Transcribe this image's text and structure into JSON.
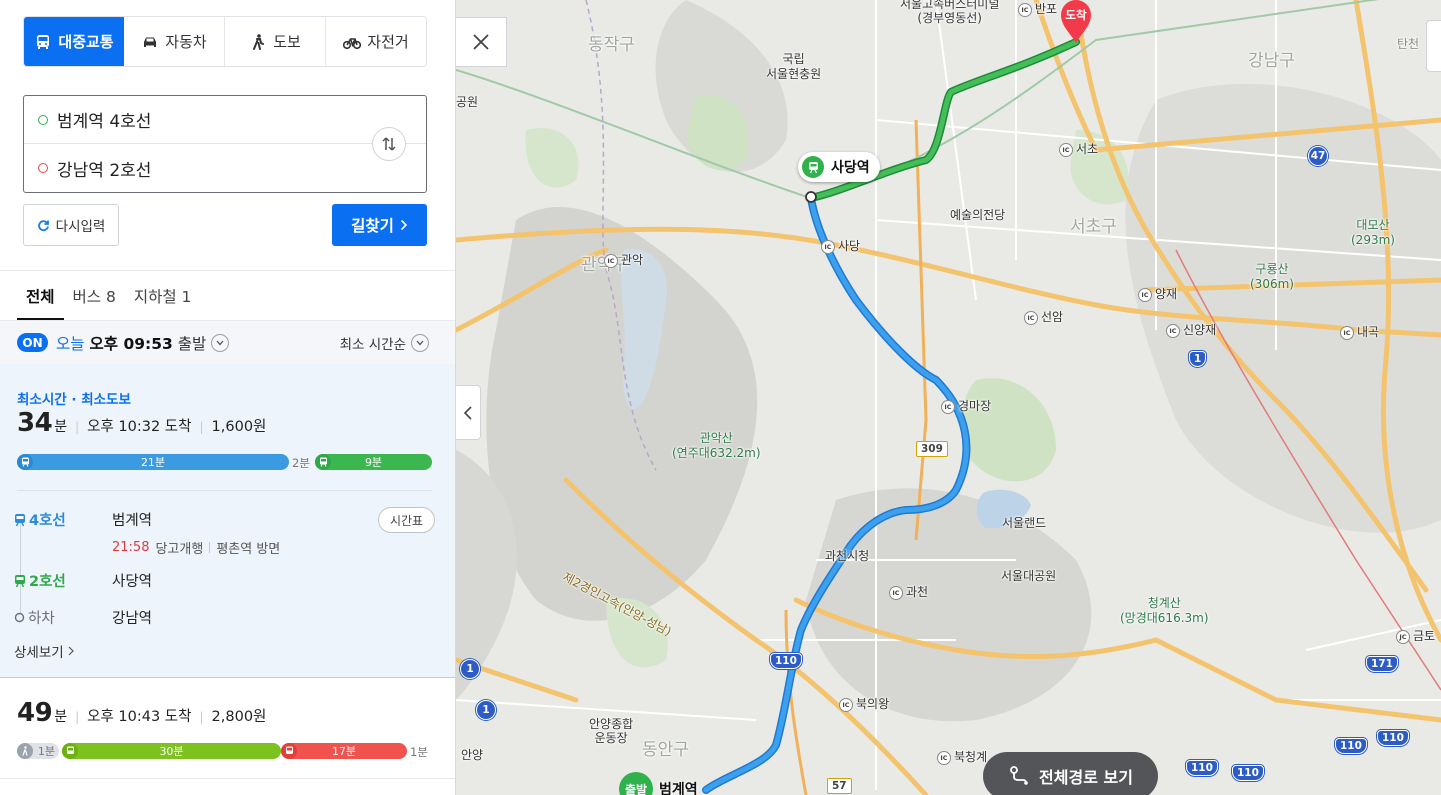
{
  "modes": [
    {
      "label": "대중교통",
      "icon": "bus-icon",
      "active": true
    },
    {
      "label": "자동차",
      "icon": "car-icon",
      "active": false
    },
    {
      "label": "도보",
      "icon": "walk-icon",
      "active": false
    },
    {
      "label": "자전거",
      "icon": "bike-icon",
      "active": false
    }
  ],
  "origin": "범계역 4호선",
  "destination": "강남역 2호선",
  "reset_label": "다시입력",
  "search_label": "길찾기",
  "tabs": {
    "all": "전체",
    "bus": "버스 8",
    "subway": "지하철 1"
  },
  "depart": {
    "badge": "ON",
    "today": "오늘",
    "time": "오후 09:53",
    "suffix": "출발"
  },
  "sort_label": "최소 시간순",
  "route1": {
    "tag": "최소시간 · 최소도보",
    "minutes": "34",
    "unit": "분",
    "arrival": "오후 10:32 도착",
    "fare": "1,600원",
    "bar": {
      "seg1": "21분",
      "gap": "2분",
      "seg2": "9분"
    },
    "steps": [
      {
        "line": "4호선",
        "station": "범계역"
      },
      {
        "line": "2호선",
        "station": "사당역"
      },
      {
        "line": "하차",
        "station": "강남역"
      }
    ],
    "next_train": "21:58",
    "direction1": "당고개행",
    "direction2": "평촌역 방면",
    "timetable": "시간표",
    "detail": "상세보기"
  },
  "route2": {
    "minutes": "49",
    "unit": "분",
    "arrival": "오후 10:43 도착",
    "fare": "2,800원",
    "bar": {
      "walk1": "1분",
      "bus1": "30분",
      "bus2": "17분",
      "walk2": "1분"
    }
  },
  "map": {
    "labels": {
      "bus_terminal": "서울고속버스터미널",
      "bus_terminal_sub": "(경부영동선)",
      "banpo": "반포",
      "dongjak": "동작구",
      "gangnam_gu": "강남구",
      "cemetery1": "국립",
      "cemetery2": "서울현충원",
      "seocho_ic": "서초",
      "seocho_gu": "서초구",
      "arts": "예술의전당",
      "sadang_ic": "사당",
      "gwanak_ic": "관악",
      "gwanak_gu": "관악구",
      "daemo1": "대모산",
      "daemo2": "(293m)",
      "guryong1": "구룡산",
      "guryong2": "(306m)",
      "yangjae": "양재",
      "sinyangjae": "신양재",
      "naegok": "내곡",
      "seonam": "선암",
      "gyeongmajang": "경마장",
      "gwanak_mt1": "관악산",
      "gwanak_mt2": "(연주대632.2m)",
      "seoulland": "서울랜드",
      "grand_park": "서울대공원",
      "gwacheon_hall": "과천시청",
      "gwacheon_ic": "과천",
      "expressway": "제2경인고속(안양-성남)",
      "cheonggye1": "청계산",
      "cheonggye2": "(망경대616.3m)",
      "geumto": "금토",
      "bukuiwang": "북의왕",
      "bukcheonggye": "북청계",
      "anyang_stadium1": "안양종합",
      "anyang_stadium2": "운동장",
      "dongan": "동안구",
      "anyang": "안양",
      "park": "공원",
      "tancheon": "탄천",
      "sadang_station": "사당역",
      "arrive": "도착",
      "start": "출발",
      "beomgye": "범계역"
    },
    "shields": [
      "47",
      "1",
      "309",
      "110",
      "1",
      "1",
      "171",
      "110",
      "110",
      "110",
      "110",
      "57"
    ],
    "full_route": "전체경로 보기"
  }
}
